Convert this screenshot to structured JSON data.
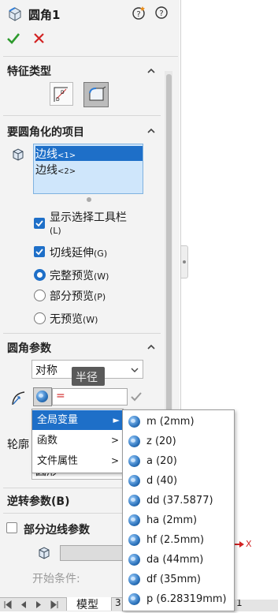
{
  "header": {
    "title": "圆角1"
  },
  "sections": {
    "feature_type": "特征类型",
    "items_to_fillet": "要圆角化的项目",
    "fillet_params": "圆角参数",
    "reverse_params": "逆转参数(B)",
    "partial_edge": "部分边线参数",
    "profile_label": "轮廓"
  },
  "edges": [
    {
      "label": "边线",
      "tag": "<1>"
    },
    {
      "label": "边线",
      "tag": "<2>"
    }
  ],
  "options": {
    "show_toolbar": "显示选择工具栏",
    "show_toolbar_key": "(L)",
    "tangent": "切线延伸",
    "tangent_key": "(G)",
    "full_preview": "完整预览",
    "full_preview_key": "(W)",
    "partial_preview": "部分预览",
    "partial_preview_key": "(P)",
    "no_preview": "无预览",
    "no_preview_key": "(W)"
  },
  "fillet": {
    "method": "对称",
    "tooltip": "半径",
    "radius_value": "=",
    "profile_value": "圆形"
  },
  "partial": {
    "start_condition": "开始条件:"
  },
  "context_menu": {
    "items": [
      "全局变量",
      "函数",
      "文件属性"
    ]
  },
  "submenu": {
    "items": [
      "m (2mm)",
      "z (20)",
      "a (20)",
      "d (40)",
      "dd (37.5877)",
      "ha (2mm)",
      "hf (2.5mm)",
      "da (44mm)",
      "df (35mm)",
      "p (6.28319mm)"
    ]
  },
  "bottom_tabs": {
    "model": "模型",
    "tab3": "3",
    "tab_num": "1"
  },
  "canvas": {
    "axis_label": "X"
  },
  "colors": {
    "accent": "#1e6fc8",
    "ok_green": "#2d9a2d",
    "cancel_red": "#d22222",
    "selection": "#1e6fc8"
  }
}
